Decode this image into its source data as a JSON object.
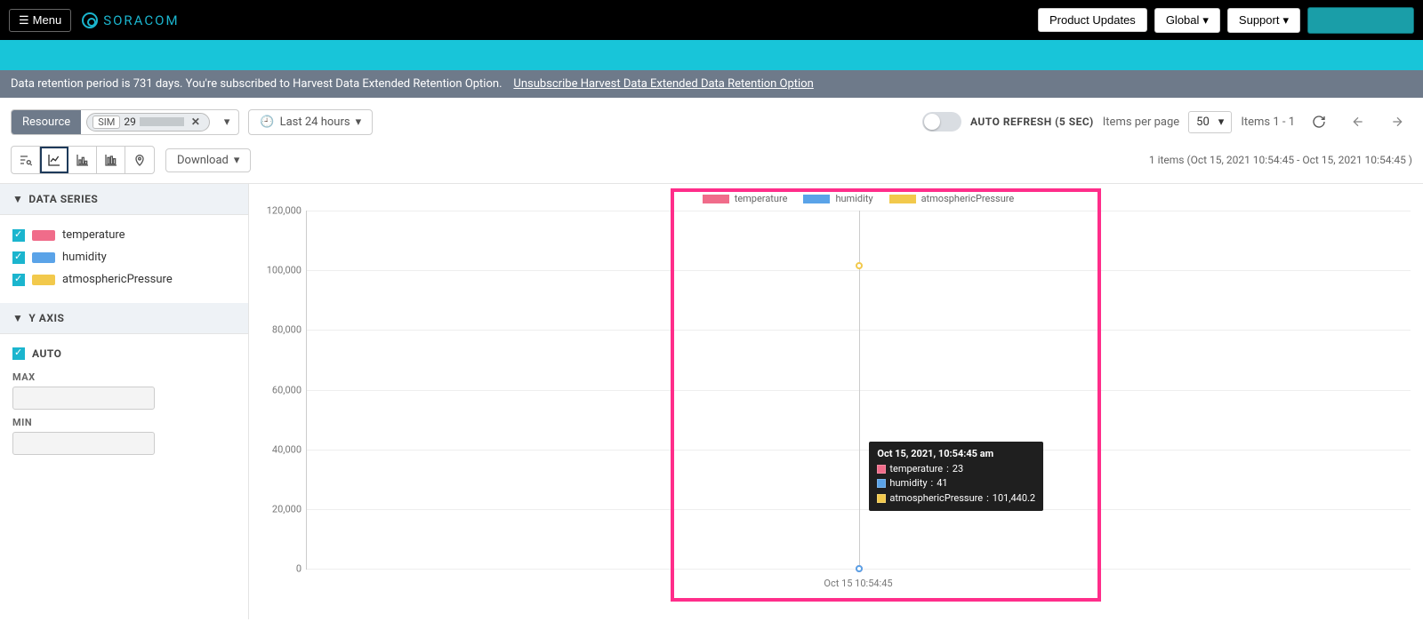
{
  "topbar": {
    "menu_label": "Menu",
    "brand": "SORACOM",
    "buttons": {
      "product_updates": "Product Updates",
      "global": "Global",
      "support": "Support"
    }
  },
  "notice": {
    "text": "Data retention period is 731 days. You're subscribed to Harvest Data Extended Retention Option.",
    "link": "Unsubscribe Harvest Data Extended Data Retention Option"
  },
  "toolbar": {
    "resource_label": "Resource",
    "sim_tag": "SIM",
    "sim_value": "29",
    "range_label": "Last 24 hours",
    "auto_refresh": "AUTO REFRESH (5 SEC)",
    "items_per_page_label": "Items per page",
    "items_per_page_value": "50",
    "items_range": "Items 1 - 1"
  },
  "viewbar": {
    "download_label": "Download",
    "items_info": "1 items (Oct 15, 2021 10:54:45  - Oct 15, 2021 10:54:45 )"
  },
  "sidebar": {
    "data_series_header": "DATA SERIES",
    "y_axis_header": "Y AXIS",
    "auto_label": "AUTO",
    "max_label": "MAX",
    "min_label": "MIN",
    "series": [
      {
        "name": "temperature",
        "color": "#f06c8a"
      },
      {
        "name": "humidity",
        "color": "#5aa3e8"
      },
      {
        "name": "atmosphericPressure",
        "color": "#f2c94c"
      }
    ]
  },
  "chart_data": {
    "type": "line",
    "x": [
      "Oct 15 10:54:45"
    ],
    "ylim": [
      0,
      120000
    ],
    "yticks": [
      0,
      20000,
      40000,
      60000,
      80000,
      100000,
      120000
    ],
    "ytick_labels": [
      "0",
      "20,000",
      "40,000",
      "60,000",
      "80,000",
      "100,000",
      "120,000"
    ],
    "series": [
      {
        "name": "temperature",
        "color": "#f06c8a",
        "values": [
          23
        ]
      },
      {
        "name": "humidity",
        "color": "#5aa3e8",
        "values": [
          41
        ]
      },
      {
        "name": "atmosphericPressure",
        "color": "#f2c94c",
        "values": [
          101440.2
        ]
      }
    ],
    "tooltip": {
      "timestamp": "Oct 15, 2021, 10:54:45 am",
      "rows": [
        {
          "label": "temperature",
          "value": "23",
          "color": "#f06c8a"
        },
        {
          "label": "humidity",
          "value": "41",
          "color": "#5aa3e8"
        },
        {
          "label": "atmosphericPressure",
          "value": "101,440.2",
          "color": "#f2c94c"
        }
      ]
    }
  }
}
